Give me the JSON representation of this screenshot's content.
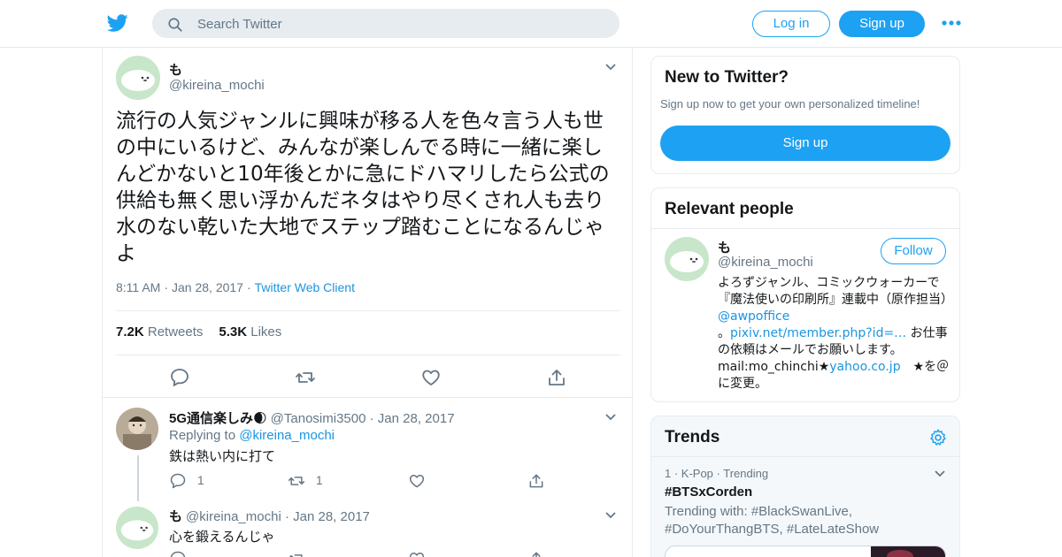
{
  "topbar": {
    "search_placeholder": "Search Twitter",
    "login_label": "Log in",
    "signup_label": "Sign up"
  },
  "tweet": {
    "name": "も",
    "handle": "@kireina_mochi",
    "text": "流行の人気ジャンルに興味が移る人を色々言う人も世の中にいるけど、みんなが楽しんでる時に一緒に楽しんどかないと10年後とかに急にドハマリしたら公式の供給も無く思い浮かんだネタはやり尽くされ人も去り水のない乾いた大地でステップ踏むことになるんじゃよ",
    "time": "8:11 AM",
    "date": "Jan 28, 2017",
    "source": "Twitter Web Client",
    "retweets_count": "7.2K",
    "retweets_label": "Retweets",
    "likes_count": "5.3K",
    "likes_label": "Likes"
  },
  "replies": [
    {
      "name": "5G通信楽しみ🌒",
      "handle": "@Tanosimi3500",
      "date": "Jan 28, 2017",
      "replying_prefix": "Replying to",
      "replying_to": "@kireina_mochi",
      "text": "鉄は熱い内に打て",
      "reply_count": "1",
      "retweet_count": "1"
    },
    {
      "name": "も",
      "handle": "@kireina_mochi",
      "date": "Jan 28, 2017",
      "text": "心を鍛えるんじゃ"
    }
  ],
  "new_to_twitter": {
    "title": "New to Twitter?",
    "subtitle": "Sign up now to get your own personalized timeline!",
    "button": "Sign up"
  },
  "relevant": {
    "title": "Relevant people",
    "name": "も",
    "handle": "@kireina_mochi",
    "follow_label": "Follow",
    "bio_1": "よろずジャンル、コミックウォーカーで『魔法使いの印刷所』連載中（原作担当）",
    "bio_link_1": "@awpoffice",
    "bio_2": "。",
    "bio_link_2": "pixiv.net/member.php?id=…",
    "bio_3": " お仕事の依頼はメールでお願いします。mail:mo_chinchi★",
    "bio_link_3": "yahoo.co.jp",
    "bio_4": "　★を＠に変更。"
  },
  "trends": {
    "title": "Trends",
    "item_meta": "1 · K-Pop · Trending",
    "item_tag": "#BTSxCorden",
    "item_with": "Trending with: #BlackSwanLive, #DoYourThangBTS, #LateLateShow"
  },
  "colors": {
    "accent": "#1da1f2",
    "link": "#1b95e0",
    "secondary_text": "#657786",
    "border": "#e6ecf0"
  }
}
